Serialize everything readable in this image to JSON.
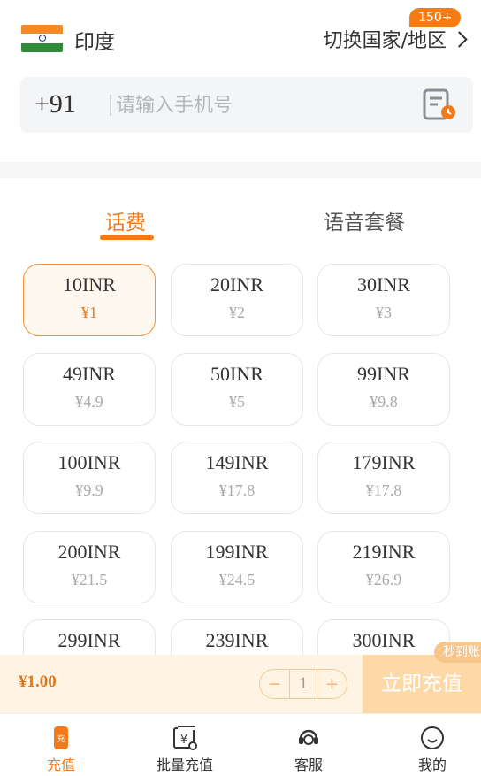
{
  "header": {
    "country": "印度",
    "switch_label": "切换国家/地区",
    "badge": "150+"
  },
  "phone": {
    "code": "+91",
    "placeholder": "请输入手机号"
  },
  "tabs": [
    {
      "label": "话费"
    },
    {
      "label": "语音套餐"
    }
  ],
  "packages": [
    {
      "amount": "10INR",
      "price": "¥1"
    },
    {
      "amount": "20INR",
      "price": "¥2"
    },
    {
      "amount": "30INR",
      "price": "¥3"
    },
    {
      "amount": "49INR",
      "price": "¥4.9"
    },
    {
      "amount": "50INR",
      "price": "¥5"
    },
    {
      "amount": "99INR",
      "price": "¥9.8"
    },
    {
      "amount": "100INR",
      "price": "¥9.9"
    },
    {
      "amount": "149INR",
      "price": "¥17.8"
    },
    {
      "amount": "179INR",
      "price": "¥17.8"
    },
    {
      "amount": "200INR",
      "price": "¥21.5"
    },
    {
      "amount": "199INR",
      "price": "¥24.5"
    },
    {
      "amount": "219INR",
      "price": "¥26.9"
    },
    {
      "amount": "299INR",
      "price": ""
    },
    {
      "amount": "239INR",
      "price": ""
    },
    {
      "amount": "300INR",
      "price": ""
    }
  ],
  "action_bar": {
    "total": "¥1.00",
    "minus": "−",
    "quantity": "1",
    "plus": "+",
    "recharge_label": "立即充值",
    "arrive_badge": "秒到账"
  },
  "nav": [
    {
      "label": "充值",
      "icon": "recharge-icon"
    },
    {
      "label": "批量充值",
      "icon": "batch-recharge-icon"
    },
    {
      "label": "客服",
      "icon": "customer-service-icon"
    },
    {
      "label": "我的",
      "icon": "profile-icon"
    }
  ],
  "colors": {
    "accent": "#f07a1c"
  }
}
